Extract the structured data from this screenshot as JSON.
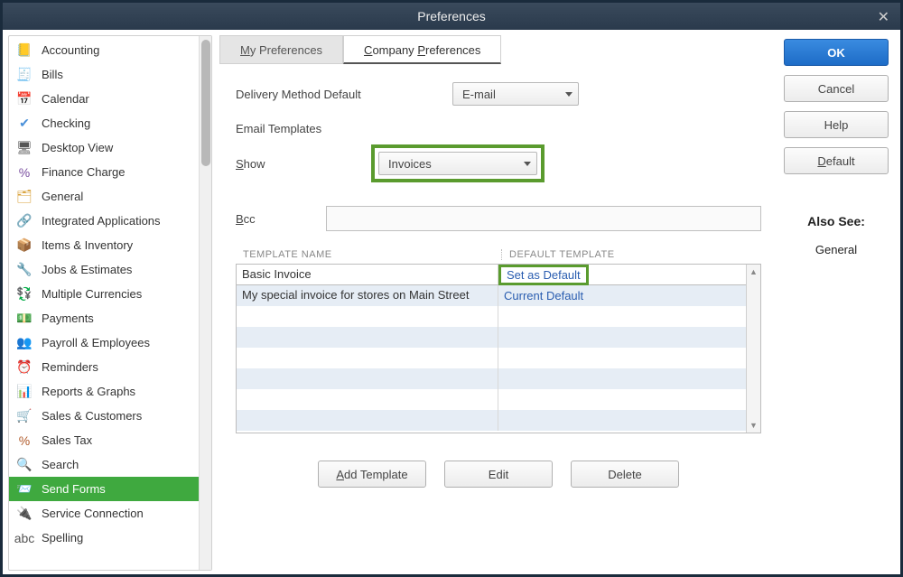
{
  "window": {
    "title": "Preferences"
  },
  "sidebar": {
    "items": [
      {
        "label": "Accounting",
        "icon": "📒",
        "color": "#e08b2c"
      },
      {
        "label": "Bills",
        "icon": "🧾",
        "color": "#3b6fa3"
      },
      {
        "label": "Calendar",
        "icon": "📅",
        "color": "#3b6fa3"
      },
      {
        "label": "Checking",
        "icon": "✔",
        "color": "#4a90d9"
      },
      {
        "label": "Desktop View",
        "icon": "🖥",
        "color": "#555"
      },
      {
        "label": "Finance Charge",
        "icon": "%",
        "color": "#7a4fa0"
      },
      {
        "label": "General",
        "icon": "🗂",
        "color": "#d9a23a"
      },
      {
        "label": "Integrated Applications",
        "icon": "🔗",
        "color": "#5f8a3a"
      },
      {
        "label": "Items & Inventory",
        "icon": "📦",
        "color": "#d9a23a"
      },
      {
        "label": "Jobs & Estimates",
        "icon": "🔧",
        "color": "#d9a23a"
      },
      {
        "label": "Multiple Currencies",
        "icon": "💱",
        "color": "#2a9a7a"
      },
      {
        "label": "Payments",
        "icon": "💵",
        "color": "#2a9a7a"
      },
      {
        "label": "Payroll & Employees",
        "icon": "👥",
        "color": "#2a9a7a"
      },
      {
        "label": "Reminders",
        "icon": "⏰",
        "color": "#d98a2a"
      },
      {
        "label": "Reports & Graphs",
        "icon": "📊",
        "color": "#2a9a4a"
      },
      {
        "label": "Sales & Customers",
        "icon": "🛒",
        "color": "#d9a23a"
      },
      {
        "label": "Sales Tax",
        "icon": "%",
        "color": "#b05a2a"
      },
      {
        "label": "Search",
        "icon": "🔍",
        "color": "#555"
      },
      {
        "label": "Send Forms",
        "icon": "📨",
        "color": "#fff",
        "selected": true
      },
      {
        "label": "Service Connection",
        "icon": "🔌",
        "color": "#555"
      },
      {
        "label": "Spelling",
        "icon": "abc",
        "color": "#555"
      }
    ]
  },
  "tabs": {
    "my_preferences": "My Preferences",
    "company_preferences": "Company Preferences",
    "active": "company_preferences"
  },
  "form": {
    "delivery_method_label": "Delivery Method Default",
    "delivery_method_value": "E-mail",
    "email_templates_label": "Email Templates",
    "show_label": "Show",
    "show_value": "Invoices",
    "bcc_label": "Bcc",
    "bcc_value": ""
  },
  "table": {
    "header_name": "TEMPLATE NAME",
    "header_default": "DEFAULT TEMPLATE",
    "rows": [
      {
        "name": "Basic Invoice",
        "default": "Set as Default",
        "highlighted": true
      },
      {
        "name": "My special invoice for stores on Main Street",
        "default": "Current Default"
      },
      {
        "name": "",
        "default": ""
      },
      {
        "name": "",
        "default": ""
      },
      {
        "name": "",
        "default": ""
      },
      {
        "name": "",
        "default": ""
      },
      {
        "name": "",
        "default": ""
      },
      {
        "name": "",
        "default": ""
      }
    ]
  },
  "actions": {
    "add_template": "Add Template",
    "edit": "Edit",
    "delete": "Delete"
  },
  "right": {
    "ok": "OK",
    "cancel": "Cancel",
    "help": "Help",
    "default": "Default",
    "also_see_title": "Also See:",
    "also_see_link": "General"
  }
}
